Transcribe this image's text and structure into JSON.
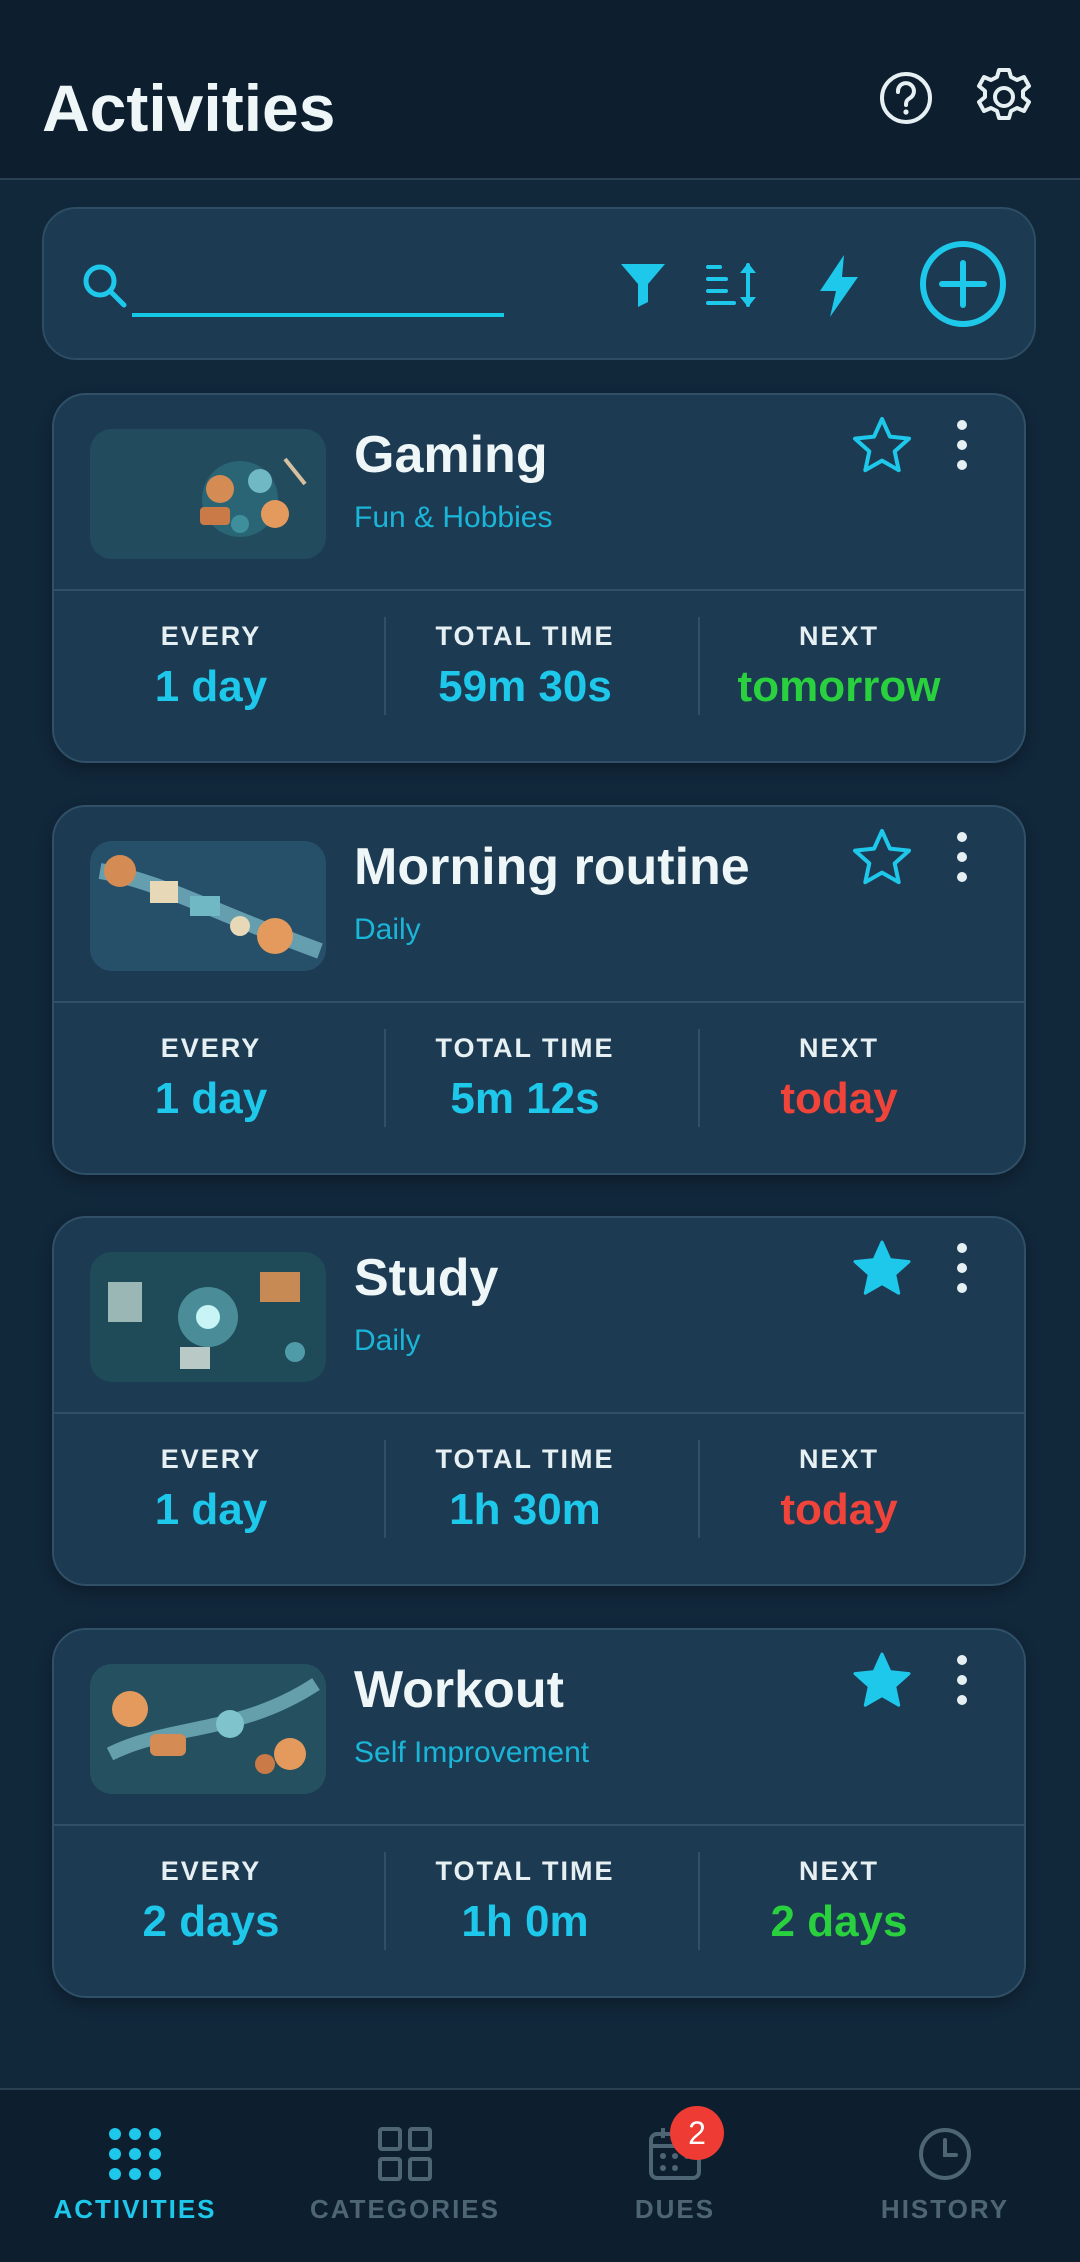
{
  "appbar": {
    "title": "Activities",
    "icons": {
      "help": "help-circle-icon",
      "settings": "gear-icon"
    }
  },
  "search": {
    "value": "",
    "placeholder": "",
    "icons": [
      "search-icon",
      "filter-icon",
      "sort-icon",
      "bolt-icon",
      "add-circle-icon"
    ]
  },
  "colors": {
    "accent": "#1ec8ea",
    "background": "#11273a",
    "card": "#1c3a52",
    "green": "#29d13e",
    "red": "#f0443a",
    "inactive": "#4d6575"
  },
  "activities": [
    {
      "title": "Gaming",
      "category": "Fun & Hobbies",
      "favorite": false,
      "stats": {
        "every_label": "EVERY",
        "every": "1 day",
        "total_label": "TOTAL TIME",
        "total": "59m 30s",
        "next_label": "NEXT",
        "next": "tomorrow"
      },
      "next_status": "green"
    },
    {
      "title": "Morning routine",
      "category": "Daily",
      "favorite": false,
      "stats": {
        "every_label": "EVERY",
        "every": "1 day",
        "total_label": "TOTAL TIME",
        "total": "5m 12s",
        "next_label": "NEXT",
        "next": "today"
      },
      "next_status": "red"
    },
    {
      "title": "Study",
      "category": "Daily",
      "favorite": true,
      "stats": {
        "every_label": "EVERY",
        "every": "1 day",
        "total_label": "TOTAL TIME",
        "total": "1h 30m",
        "next_label": "NEXT",
        "next": "today"
      },
      "next_status": "red"
    },
    {
      "title": "Workout",
      "category": "Self Improvement",
      "favorite": true,
      "stats": {
        "every_label": "EVERY",
        "every": "2 days",
        "total_label": "TOTAL TIME",
        "total": "1h 0m",
        "next_label": "NEXT",
        "next": "2 days"
      },
      "next_status": "green"
    }
  ],
  "bottomnav": {
    "items": [
      {
        "label": "ACTIVITIES",
        "icon": "grid-dots-icon",
        "active": true
      },
      {
        "label": "CATEGORIES",
        "icon": "grid-squares-icon",
        "active": false
      },
      {
        "label": "DUES",
        "icon": "calendar-icon",
        "active": false,
        "badge": "2"
      },
      {
        "label": "HISTORY",
        "icon": "clock-icon",
        "active": false
      }
    ]
  }
}
